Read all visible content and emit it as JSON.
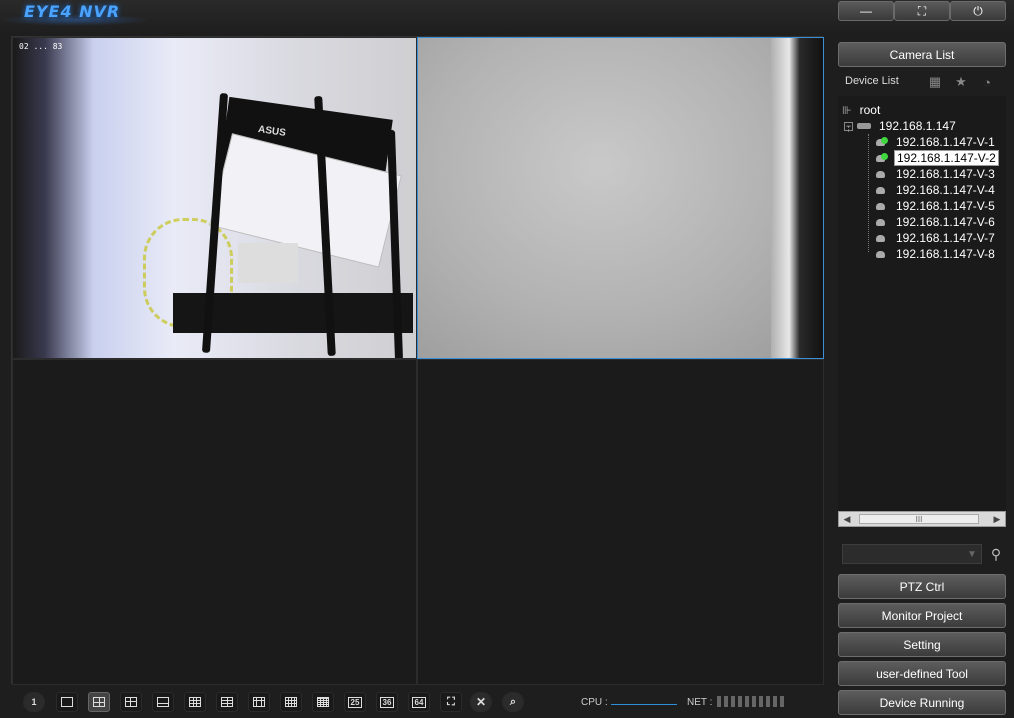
{
  "app": {
    "logo": "EYE4 NVR"
  },
  "window_controls": {
    "minimize": "—",
    "maximize": "⛶",
    "power": "⏻"
  },
  "video": {
    "cam1_timestamp": "02 ... 83"
  },
  "right_panel": {
    "camera_list": "Camera List",
    "device_list": "Device List",
    "tree": {
      "root": "root",
      "device": "192.168.1.147",
      "channels": [
        {
          "label": "192.168.1.147-V-1",
          "online": true
        },
        {
          "label": "192.168.1.147-V-2",
          "online": true
        },
        {
          "label": "192.168.1.147-V-3",
          "online": false
        },
        {
          "label": "192.168.1.147-V-4",
          "online": false
        },
        {
          "label": "192.168.1.147-V-5",
          "online": false
        },
        {
          "label": "192.168.1.147-V-6",
          "online": false
        },
        {
          "label": "192.168.1.147-V-7",
          "online": false
        },
        {
          "label": "192.168.1.147-V-8",
          "online": false
        }
      ],
      "selected_index": 1
    },
    "scroll_thumb": "III",
    "search_placeholder": "",
    "buttons": {
      "ptz": "PTZ Ctrl",
      "monitor_project": "Monitor Project",
      "setting": "Setting",
      "user_defined": "user-defined Tool",
      "device_running": "Device Running"
    }
  },
  "toolbar": {
    "single_label": "1",
    "n25": "25",
    "n36": "36",
    "n64": "64",
    "cpu_label": "CPU :",
    "net_label": "NET :"
  },
  "colors": {
    "accent": "#3a8fd6",
    "online": "#3fd63f",
    "logo": "#4aa3ff"
  }
}
